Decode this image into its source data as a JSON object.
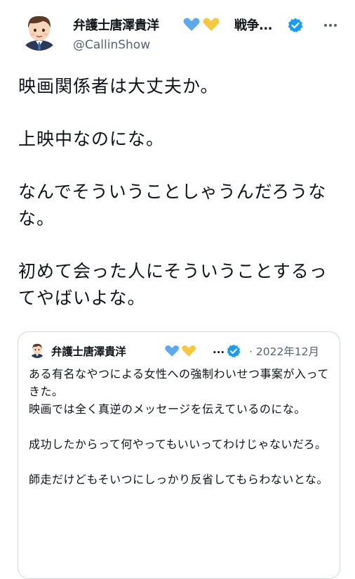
{
  "tweet": {
    "author": {
      "display_name": "弁護士唐澤貴洋",
      "name_suffix": "戦争...",
      "handle": "@CallinShow",
      "badges": [
        "blue-heart-icon",
        "yellow-heart-icon"
      ],
      "verified_icon": "verified-badge-icon",
      "more_icon": "more-options-icon"
    },
    "paragraphs": [
      "映画関係者は大丈夫か。",
      "上映中なのにな。",
      "なんでそういうことしゃうんだろうなな。",
      "初めて会った人にそういうことするってやばいよな。"
    ]
  },
  "quoted_tweet": {
    "author": {
      "display_name": "弁護士唐澤貴洋",
      "name_suffix": "...",
      "badges": [
        "blue-heart-icon",
        "yellow-heart-icon"
      ],
      "verified_icon": "verified-badge-icon"
    },
    "date": "· 2022年12月",
    "paragraphs": [
      "ある有名なやつによる女性への強制わいせつ事案が入ってきた。\n映画では全く真逆のメッセージを伝えているのにな。",
      "成功したからって何やってもいいってわけじゃないだろ。",
      "師走だけどもそいつにしっかり反省してもらわないとな。"
    ]
  },
  "colors": {
    "text": "#0f1419",
    "secondary_text": "#536471",
    "verified_blue": "#1d9bf0",
    "heart_blue": "#5fa8ec",
    "heart_yellow": "#f5c842",
    "border": "#cfd9de"
  }
}
